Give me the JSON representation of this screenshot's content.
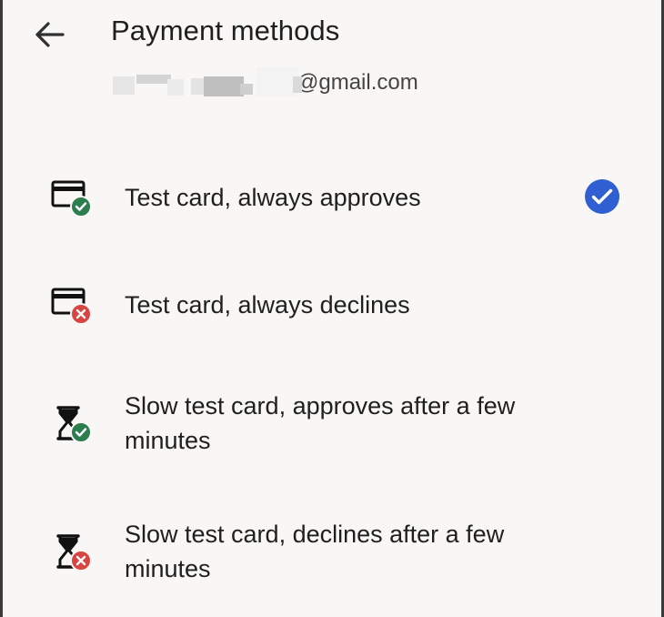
{
  "header": {
    "title": "Payment methods",
    "account_email_visible": "@gmail.com"
  },
  "methods": [
    {
      "label": "Test card, always approves",
      "icon": "credit-card-approved-icon",
      "selected": true
    },
    {
      "label": "Test card, always declines",
      "icon": "credit-card-declined-icon",
      "selected": false
    },
    {
      "label": "Slow test card, approves after a few minutes",
      "icon": "hourglass-approved-icon",
      "selected": false
    },
    {
      "label": "Slow test card, declines after a few minutes",
      "icon": "hourglass-declined-icon",
      "selected": false
    }
  ],
  "colors": {
    "background": "#f8f7f5",
    "success": "#2e7d4f",
    "error": "#d64541",
    "selected": "#2f5fd0"
  }
}
